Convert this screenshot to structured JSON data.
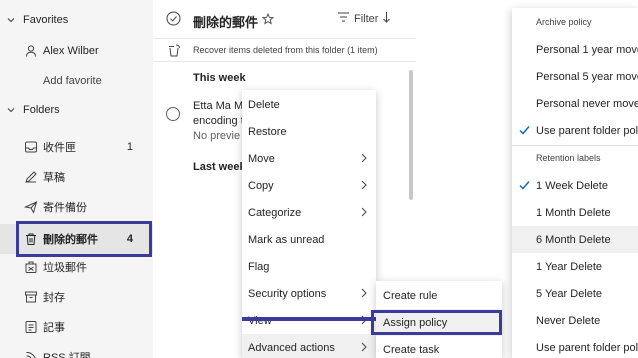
{
  "sidebar": {
    "favorites_label": "Favorites",
    "favorites": [
      {
        "label": "Alex Wilber",
        "icon": "person-icon"
      },
      {
        "label": "Add favorite",
        "icon": "none"
      }
    ],
    "folders_label": "Folders",
    "folders": [
      {
        "label": "收件匣",
        "count": "1",
        "icon": "inbox-icon"
      },
      {
        "label": "草稿",
        "count": "",
        "icon": "pencil-icon"
      },
      {
        "label": "寄件備份",
        "count": "",
        "icon": "send-icon"
      },
      {
        "label": "刪除的郵件",
        "count": "4",
        "icon": "trash-icon"
      },
      {
        "label": "垃圾郵件",
        "count": "",
        "icon": "junk-icon"
      },
      {
        "label": "封存",
        "count": "",
        "icon": "archive-icon"
      },
      {
        "label": "記事",
        "count": "",
        "icon": "note-icon"
      },
      {
        "label": "RSS 訂閱",
        "count": "",
        "icon": "rss-icon"
      }
    ]
  },
  "list": {
    "title": "刪除的郵件",
    "filter_label": "Filter",
    "recover_text": "Recover items deleted from this folder (1 item)",
    "group_this_week": "This week",
    "group_last_week": "Last week",
    "message": {
      "sender": "Etta Ma M",
      "subject": "encoding t",
      "preview": "No previe"
    }
  },
  "context_menu": {
    "items": [
      {
        "label": "Delete",
        "has_submenu": false
      },
      {
        "label": "Restore",
        "has_submenu": false
      },
      {
        "label": "Move",
        "has_submenu": true
      },
      {
        "label": "Copy",
        "has_submenu": true
      },
      {
        "label": "Categorize",
        "has_submenu": true
      },
      {
        "label": "Mark as unread",
        "has_submenu": false
      },
      {
        "label": "Flag",
        "has_submenu": false
      },
      {
        "label": "Security options",
        "has_submenu": true
      },
      {
        "label": "View",
        "has_submenu": true
      },
      {
        "label": "Advanced actions",
        "has_submenu": true
      }
    ]
  },
  "submenu": {
    "items": [
      {
        "label": "Create rule"
      },
      {
        "label": "Assign policy"
      },
      {
        "label": "Create task"
      }
    ]
  },
  "policy_menu": {
    "archive_header": "Archive policy",
    "archive_items": [
      {
        "label": "Personal 1 year move",
        "checked": false
      },
      {
        "label": "Personal 5 year move",
        "checked": false
      },
      {
        "label": "Personal never move t",
        "checked": false
      },
      {
        "label": "Use parent folder polic",
        "checked": true
      }
    ],
    "retention_header": "Retention labels",
    "retention_items": [
      {
        "label": "1 Week Delete",
        "checked": true
      },
      {
        "label": "1 Month Delete",
        "checked": false
      },
      {
        "label": "6 Month Delete",
        "checked": false
      },
      {
        "label": "1 Year Delete",
        "checked": false
      },
      {
        "label": "5 Year Delete",
        "checked": false
      },
      {
        "label": "Never Delete",
        "checked": false
      },
      {
        "label": "Use parent folder polic",
        "checked": false
      }
    ]
  },
  "colors": {
    "accent": "#0f6cbd",
    "annotation": "#3b3b9e",
    "sidebar_bg": "#f5f5f5"
  }
}
